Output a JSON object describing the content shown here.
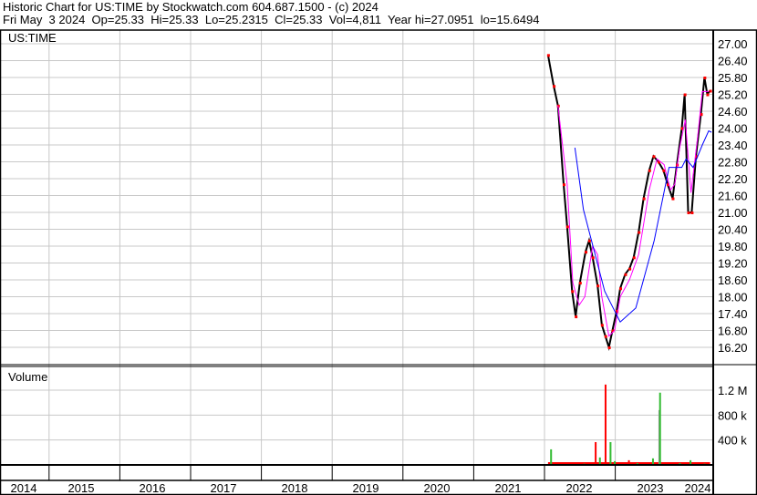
{
  "header": {
    "title": "Historic Chart for US:TIME by Stockwatch.com 604.687.1500 - (c) 2024",
    "quote": "Fri May  3 2024  Op=25.33  Hi=25.33  Lo=25.2315  Cl=25.33  Vol=4,811  Year hi=27.0951  lo=15.6494"
  },
  "chart_data": {
    "type": "line",
    "symbol_label": "US:TIME",
    "volume_label": "Volume",
    "x_tick_labels": [
      "2014",
      "2015",
      "2016",
      "2017",
      "2018",
      "2019",
      "2020",
      "2021",
      "2022",
      "2023",
      "2024"
    ],
    "price_ticks": [
      "27.00",
      "26.40",
      "25.80",
      "25.20",
      "24.60",
      "24.00",
      "23.40",
      "22.80",
      "22.20",
      "21.60",
      "21.00",
      "20.40",
      "19.80",
      "19.20",
      "18.60",
      "18.00",
      "17.40",
      "16.80",
      "16.20"
    ],
    "price_ylim": [
      15.9,
      27.2
    ],
    "volume_ticks": [
      "1.2 M",
      "800 k",
      "400 k"
    ],
    "volume_tick_values": [
      1200000,
      800000,
      400000
    ],
    "colors": {
      "price": "#000000",
      "price_marks": "#ff0000",
      "ma_short": "#ff00ff",
      "ma_long": "#0000ff",
      "vol_up": "#33bb33",
      "vol_down": "#ff0000",
      "vol_flat": "#999999",
      "grid": "#c8c8c8"
    },
    "price_series": {
      "x": [
        2022.05,
        2022.13,
        2022.19,
        2022.27,
        2022.32,
        2022.39,
        2022.44,
        2022.5,
        2022.58,
        2022.63,
        2022.68,
        2022.75,
        2022.81,
        2022.86,
        2022.91,
        2022.96,
        2023.02,
        2023.07,
        2023.14,
        2023.2,
        2023.26,
        2023.33,
        2023.4,
        2023.48,
        2023.54,
        2023.61,
        2023.68,
        2023.74,
        2023.81,
        2023.87,
        2023.94,
        2023.98,
        2024.03,
        2024.08,
        2024.14,
        2024.21,
        2024.26,
        2024.3,
        2024.34
      ],
      "y": [
        26.6,
        25.5,
        24.8,
        22.0,
        20.5,
        18.2,
        17.3,
        18.5,
        19.6,
        20.0,
        19.4,
        18.4,
        17.0,
        16.6,
        16.2,
        16.8,
        17.5,
        18.3,
        18.8,
        19.0,
        19.4,
        20.3,
        21.5,
        22.5,
        23.0,
        22.8,
        22.5,
        22.0,
        21.5,
        22.7,
        24.0,
        25.2,
        21.0,
        21.0,
        23.0,
        24.5,
        25.8,
        25.2,
        25.33
      ]
    },
    "ma_short": {
      "x": [
        2022.19,
        2022.32,
        2022.4,
        2022.49,
        2022.57,
        2022.68,
        2022.75,
        2022.81,
        2022.91,
        2022.99,
        2023.07,
        2023.2,
        2023.33,
        2023.48,
        2023.59,
        2023.69,
        2023.78,
        2023.84,
        2023.91,
        2023.99,
        2024.07,
        2024.16,
        2024.23,
        2024.32
      ],
      "y": [
        24.8,
        22.0,
        18.5,
        17.7,
        18.0,
        19.8,
        19.5,
        18.0,
        16.6,
        16.8,
        18.0,
        18.6,
        19.5,
        21.8,
        22.9,
        22.7,
        21.8,
        22.0,
        23.3,
        24.3,
        21.7,
        23.6,
        25.3,
        25.3
      ]
    },
    "ma_long": {
      "x": [
        2022.43,
        2022.55,
        2022.85,
        2023.07,
        2023.29,
        2023.55,
        2023.76,
        2023.94,
        2024.0,
        2024.1,
        2024.23,
        2024.32,
        2024.36
      ],
      "y": [
        23.3,
        21.1,
        18.2,
        17.1,
        17.6,
        20.0,
        22.6,
        22.6,
        22.9,
        22.6,
        23.4,
        23.9,
        23.85
      ]
    },
    "volume_series": {
      "x": [
        2022.08,
        2022.2,
        2022.4,
        2022.55,
        2022.71,
        2022.77,
        2022.85,
        2022.92,
        2022.98,
        2023.05,
        2023.18,
        2023.3,
        2023.52,
        2023.61,
        2023.62,
        2023.66,
        2023.9,
        2024.05,
        2024.15,
        2024.25
      ],
      "v": [
        250000,
        40000,
        15000,
        20000,
        366000,
        120000,
        1290000,
        366000,
        60000,
        40000,
        75000,
        30000,
        105000,
        880000,
        1160000,
        25000,
        30000,
        75000,
        20000,
        20000
      ],
      "dir": [
        "up",
        "down",
        "down",
        "up",
        "down",
        "up",
        "down",
        "up",
        "up",
        "down",
        "down",
        "up",
        "up",
        "flat",
        "up",
        "down",
        "up",
        "up",
        "down",
        "up"
      ]
    }
  }
}
